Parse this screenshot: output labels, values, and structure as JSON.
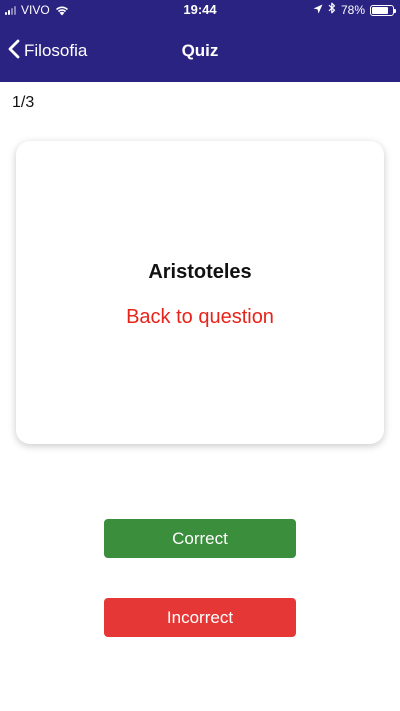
{
  "status_bar": {
    "carrier": "VIVO",
    "time": "19:44",
    "battery_percent": "78%",
    "battery_level": 0.78,
    "icons": [
      "signal-icon",
      "wifi-icon",
      "location-arrow-icon",
      "bluetooth-icon",
      "battery-icon"
    ]
  },
  "nav": {
    "back_label": "Filosofia",
    "title": "Quiz",
    "back_icon": "chevron-left-icon"
  },
  "quiz": {
    "progress": "1/3",
    "answer": "Aristoteles",
    "back_to_question": "Back to question"
  },
  "actions": {
    "correct_label": "Correct",
    "incorrect_label": "Incorrect"
  },
  "colors": {
    "header_bg": "#2a2381",
    "accent_red": "#e8231a",
    "correct_bg": "#3a8e3c",
    "incorrect_bg": "#e53836"
  }
}
